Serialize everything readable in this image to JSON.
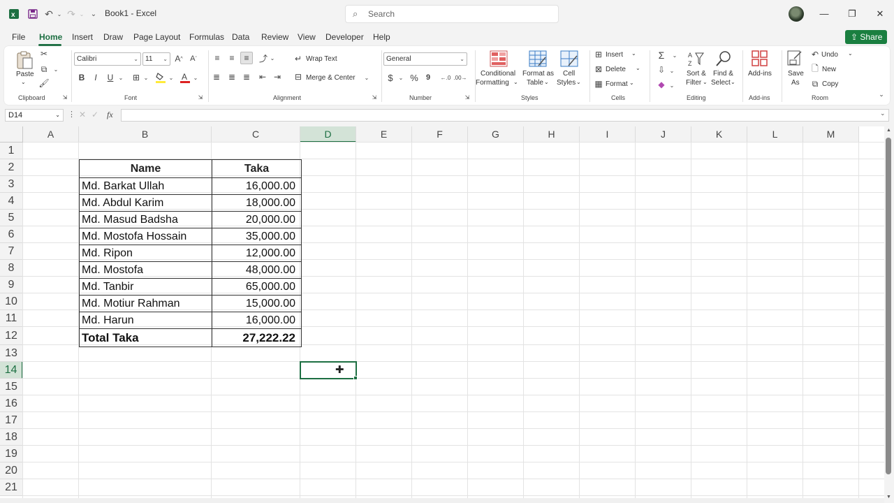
{
  "titlebar": {
    "doc_title": "Book1 - Excel",
    "search_placeholder": "Search"
  },
  "menu": {
    "tabs": [
      "File",
      "Home",
      "Insert",
      "Draw",
      "Page Layout",
      "Formulas",
      "Data",
      "Review",
      "View",
      "Developer",
      "Help"
    ],
    "share_label": "Share"
  },
  "ribbon": {
    "clipboard": {
      "paste": "Paste",
      "label": "Clipboard"
    },
    "font": {
      "name": "Calibri",
      "size": "11",
      "label": "Font",
      "bold": "B",
      "italic": "I",
      "underline": "U"
    },
    "alignment": {
      "wrap": "Wrap Text",
      "merge": "Merge & Center",
      "label": "Alignment"
    },
    "number": {
      "format": "General",
      "currency": "$",
      "percent": "%",
      "comma": "9",
      "label": "Number"
    },
    "styles": {
      "cond1": "Conditional",
      "cond2": "Formatting",
      "table1": "Format as",
      "table2": "Table",
      "cell1": "Cell",
      "cell2": "Styles",
      "label": "Styles"
    },
    "cells": {
      "insert": "Insert",
      "delete": "Delete",
      "format": "Format",
      "label": "Cells"
    },
    "editing": {
      "sort1": "Sort &",
      "sort2": "Filter",
      "find1": "Find &",
      "find2": "Select",
      "label": "Editing"
    },
    "addins": {
      "button": "Add-ins",
      "label": "Add-ins"
    },
    "room": {
      "save1": "Save",
      "save2": "As",
      "undo": "Undo",
      "new": "New",
      "copy": "Copy",
      "label": "Room"
    }
  },
  "formula_bar": {
    "name_box": "D14",
    "fx": "fx",
    "content": ""
  },
  "columns": [
    "A",
    "B",
    "C",
    "D",
    "E",
    "F",
    "G",
    "H",
    "I",
    "J",
    "K",
    "L",
    "M"
  ],
  "selected_column": "D",
  "rows": [
    "1",
    "2",
    "3",
    "4",
    "5",
    "6",
    "7",
    "8",
    "9",
    "10",
    "11",
    "12",
    "13",
    "14",
    "15",
    "16",
    "17",
    "18",
    "19",
    "20",
    "21"
  ],
  "selected_row": "14",
  "sheet": {
    "headers": [
      "Name",
      "Taka"
    ],
    "rows": [
      {
        "name": "Md. Barkat Ullah",
        "taka": "16,000.00"
      },
      {
        "name": "Md. Abdul Karim",
        "taka": "18,000.00"
      },
      {
        "name": "Md. Masud Badsha",
        "taka": "20,000.00"
      },
      {
        "name": "Md. Mostofa Hossain",
        "taka": "35,000.00"
      },
      {
        "name": "Md. Ripon",
        "taka": "12,000.00"
      },
      {
        "name": "Md. Mostofa",
        "taka": "48,000.00"
      },
      {
        "name": "Md. Tanbir",
        "taka": "65,000.00"
      },
      {
        "name": "Md. Motiur Rahman",
        "taka": "15,000.00"
      },
      {
        "name": "Md. Harun",
        "taka": "16,000.00"
      }
    ],
    "total": {
      "name": "Total Taka",
      "taka": "27,222.22"
    }
  },
  "colors": {
    "accent": "#1d6f42",
    "share": "#1a7f40"
  }
}
